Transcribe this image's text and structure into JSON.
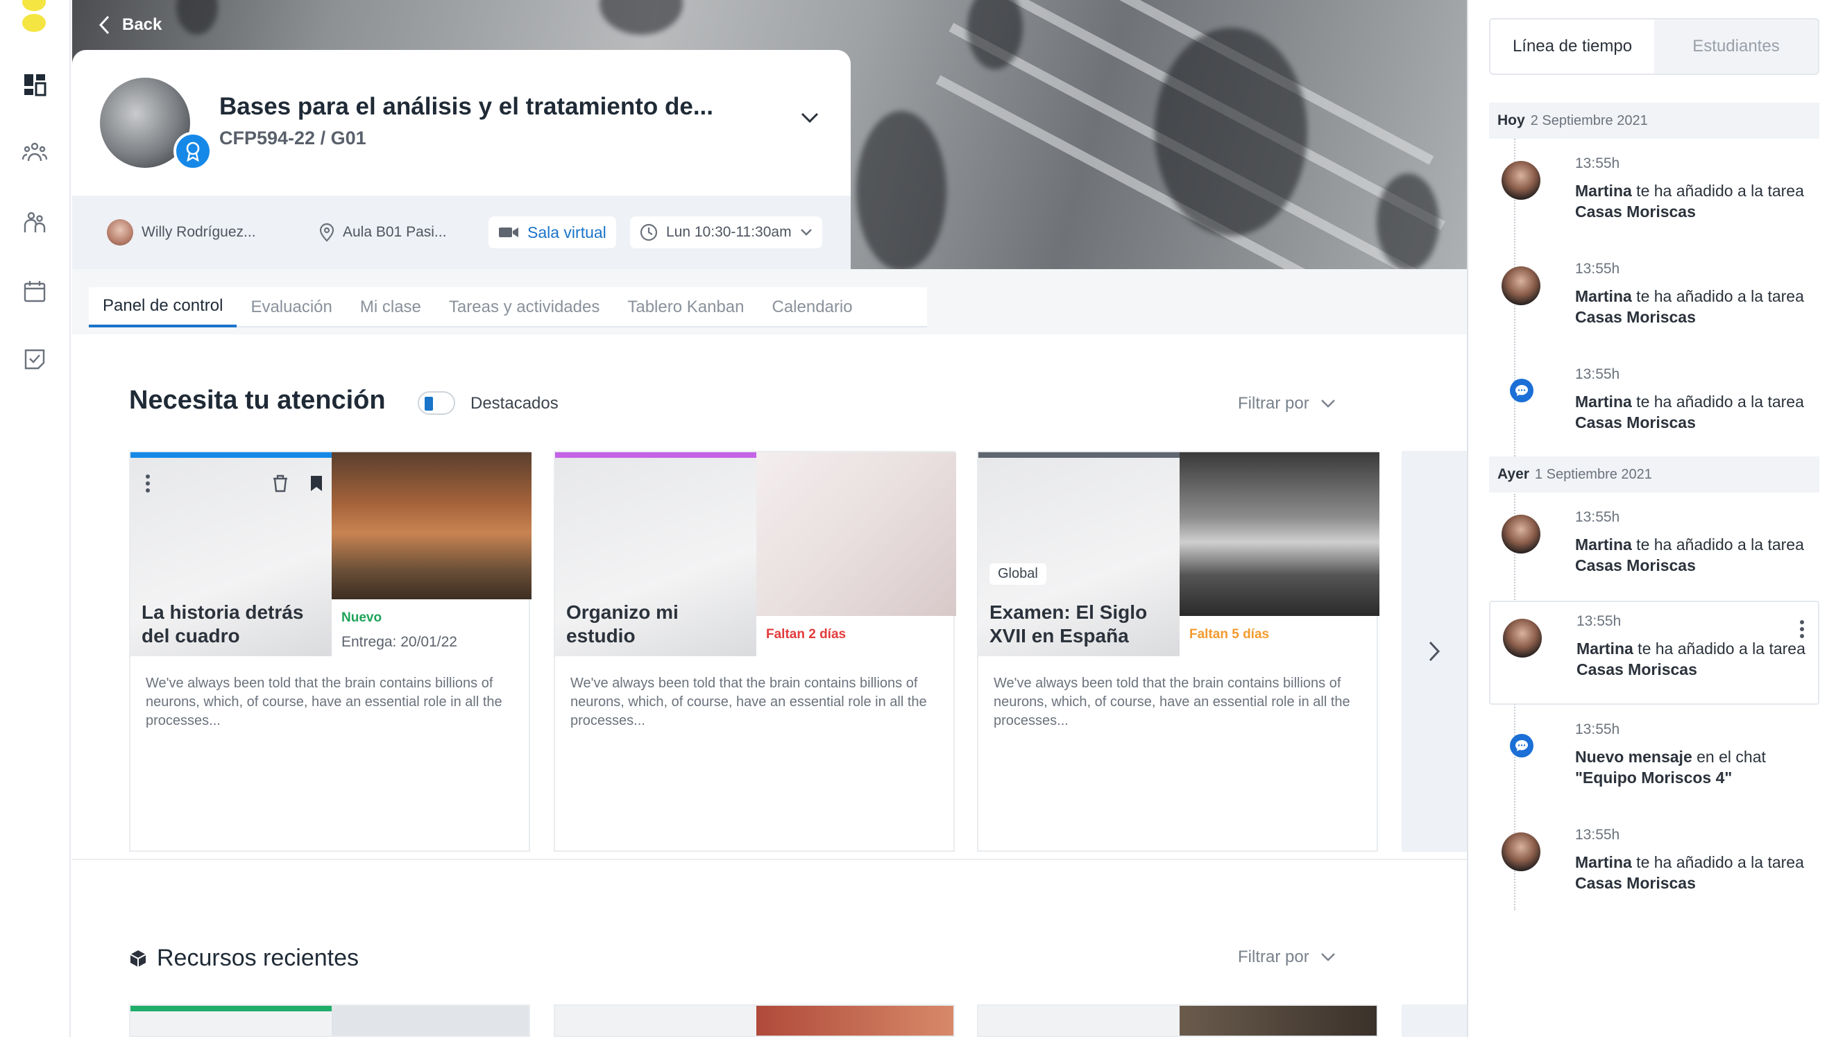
{
  "colors": {
    "accent": "#1a74c9",
    "new_green": "#1fa35a",
    "urgent_red": "#e23b3b",
    "warning_orange": "#f39a2d",
    "card1_bar": "#1689e8",
    "card2_bar": "#c463e6",
    "card3_bar": "#5f6670",
    "res1_bar": "#1fae6a"
  },
  "rail": {
    "icons": [
      "dashboard-icon",
      "community-icon",
      "people-icon",
      "calendar-icon",
      "tasks-icon"
    ]
  },
  "header": {
    "back_label": "Back",
    "course_title": "Bases para el análisis y el tratamiento de...",
    "course_code": "CFP594-22 / G01",
    "teacher": "Willy Rodríguez...",
    "room": "Aula B01 Pasi...",
    "virtual_room": "Sala virtual",
    "schedule": "Lun 10:30-11:30am"
  },
  "tabs": [
    "Panel de control",
    "Evaluación",
    "Mi clase",
    "Tareas y actividades",
    "Tablero Kanban",
    "Calendario"
  ],
  "attention": {
    "title": "Necesita tu atención",
    "toggle_label": "Destacados",
    "filter_label": "Filtrar por",
    "cards": [
      {
        "title": "La historia detrás del cuadro",
        "status": "Nuevo",
        "due": "Entrega: 20/01/22",
        "desc": "We've always been told that the brain contains billions of neurons, which, of course, have an essential role in all the processes..."
      },
      {
        "title": "Organizo mi estudio",
        "status": "Faltan 2 días",
        "due": "",
        "desc": "We've always been told that the brain contains billions of neurons, which, of course, have an essential role in all the processes..."
      },
      {
        "title": "Examen: El Siglo XVII en España",
        "status": "Faltan 5 días",
        "due": "",
        "badge": "Global",
        "desc": "We've always been told that the brain contains billions of neurons, which, of course, have an essential role in all the processes..."
      }
    ]
  },
  "resources": {
    "title": "Recursos recientes",
    "filter_label": "Filtrar por"
  },
  "panel": {
    "tabs": [
      "Línea de tiempo",
      "Estudiantes"
    ],
    "today_label": "Hoy",
    "today_date": "2 Septiembre 2021",
    "yesterday_label": "Ayer",
    "yesterday_date": "1 Septiembre 2021",
    "events": [
      {
        "time": "13:55h",
        "actor": "Martina",
        "text": " te ha añadido a la tarea ",
        "target": "Casas Moriscas"
      },
      {
        "time": "13:55h",
        "actor": "Martina",
        "text": " te ha añadido a la tarea ",
        "target": "Casas Moriscas"
      },
      {
        "time": "13:55h",
        "actor": "Martina",
        "text": " te ha añadido a la tarea ",
        "target": "Casas Moriscas"
      },
      {
        "time": "13:55h",
        "actor": "Martina",
        "text": " te ha añadido a la tarea ",
        "target": "Casas Moriscas"
      },
      {
        "time": "13:55h",
        "actor": "Martina",
        "text": " te ha añadido a la tarea ",
        "target": "Casas Moriscas"
      },
      {
        "time": "13:55h",
        "actor": "Nuevo mensaje",
        "text": " en el chat ",
        "target": "\"Equipo Moriscos 4\""
      },
      {
        "time": "13:55h",
        "actor": "Martina",
        "text": " te ha añadido a la tarea ",
        "target": "Casas Moriscas"
      }
    ]
  }
}
